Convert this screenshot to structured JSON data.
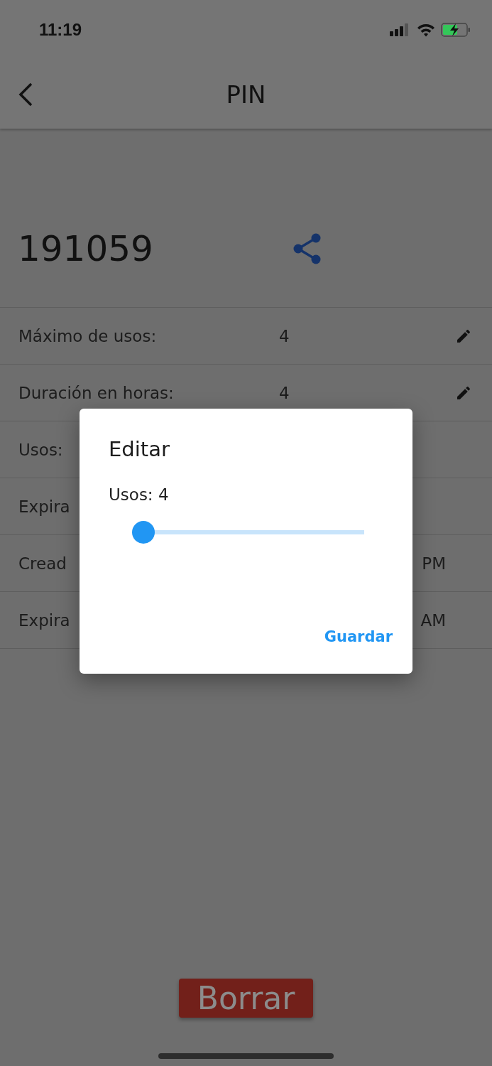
{
  "status_bar": {
    "time": "11:19"
  },
  "header": {
    "title": "PIN"
  },
  "pin": {
    "code": "191059"
  },
  "rows": [
    {
      "kind": "editable",
      "label": "Máximo de usos:",
      "value": "4"
    },
    {
      "kind": "editable",
      "label": "Duración en horas:",
      "value": "4"
    },
    {
      "kind": "info",
      "label": "Usos:"
    },
    {
      "kind": "info",
      "label": "Expira"
    },
    {
      "kind": "info",
      "label": "Cread",
      "value": "PM"
    },
    {
      "kind": "info",
      "label": "Expira",
      "value": "AM"
    }
  ],
  "dialog": {
    "title": "Editar",
    "label": "Usos: 4",
    "slider": {
      "level": 0
    },
    "action": "Guardar"
  },
  "delete_button": "Borrar"
}
